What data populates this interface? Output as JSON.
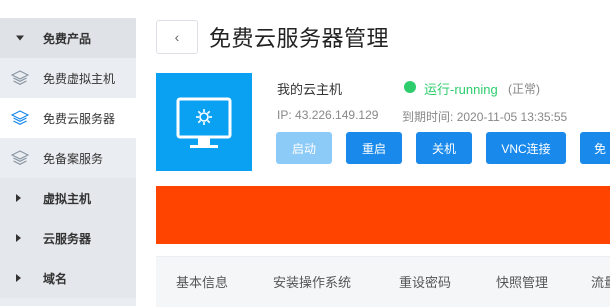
{
  "sidebar": {
    "group_free": "免费产品",
    "items": [
      {
        "label": "免费虚拟主机",
        "icon": "layers-icon"
      },
      {
        "label": "免费云服务器",
        "icon": "layers-icon"
      },
      {
        "label": "免备案服务",
        "icon": "layers-icon"
      }
    ],
    "parents": [
      {
        "label": "虚拟主机"
      },
      {
        "label": "云服务器"
      },
      {
        "label": "域名"
      }
    ]
  },
  "header": {
    "back_glyph": "‹",
    "title": "免费云服务器管理"
  },
  "server": {
    "name": "我的云主机",
    "status": "运行-running",
    "status_note": "(正常)",
    "ip_label": "IP:",
    "ip": "43.226.149.129",
    "expire_label": "到期时间:",
    "expire": "2020-11-05 13:35:55",
    "icon": "monitor-icon"
  },
  "actions": {
    "start": "启动",
    "restart": "重启",
    "shutdown": "关机",
    "vnc": "VNC连接",
    "more": "免"
  },
  "tabs": [
    "基本信息",
    "安装操作系统",
    "重设密码",
    "快照管理",
    "流量"
  ],
  "colors": {
    "accent": "#1a89ec",
    "running": "#2dcd6d",
    "banner": "#ff4400",
    "tile": "#0aa1f3"
  }
}
